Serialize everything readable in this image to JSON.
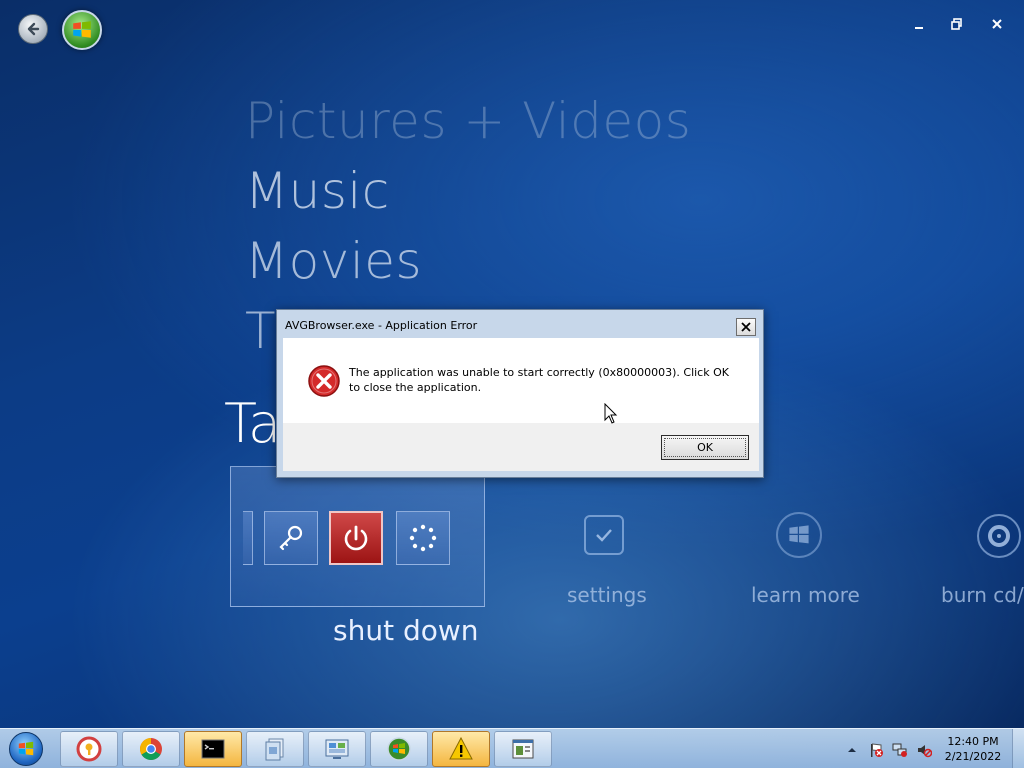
{
  "media_center": {
    "menu": {
      "pictures": "Pictures + Videos",
      "music": "Music",
      "movies": "Movies",
      "tv_partial": "T",
      "tasks_partial": "Ta"
    },
    "tasks_strip": {
      "shutdown_label": "shut down",
      "settings_label": "settings",
      "learn_more_label": "learn more",
      "burn_label": "burn cd/"
    }
  },
  "dialog": {
    "title": "AVGBrowser.exe - Application Error",
    "message": "The application was unable to start correctly (0x80000003). Click OK to close the application.",
    "ok_label": "OK"
  },
  "taskbar": {
    "pinned": [
      "start-orb",
      "avg-browser",
      "chrome",
      "command-prompt",
      "windows-explorer",
      "control-panel",
      "media-center",
      "warning",
      "network-window"
    ],
    "clock_time": "12:40 PM",
    "clock_date": "2/21/2022"
  },
  "colors": {
    "background": "#0c3c86",
    "dialog_frame": "#c7d7ea",
    "power_tile": "#b82828",
    "taskbar": "#b6d0ea"
  }
}
